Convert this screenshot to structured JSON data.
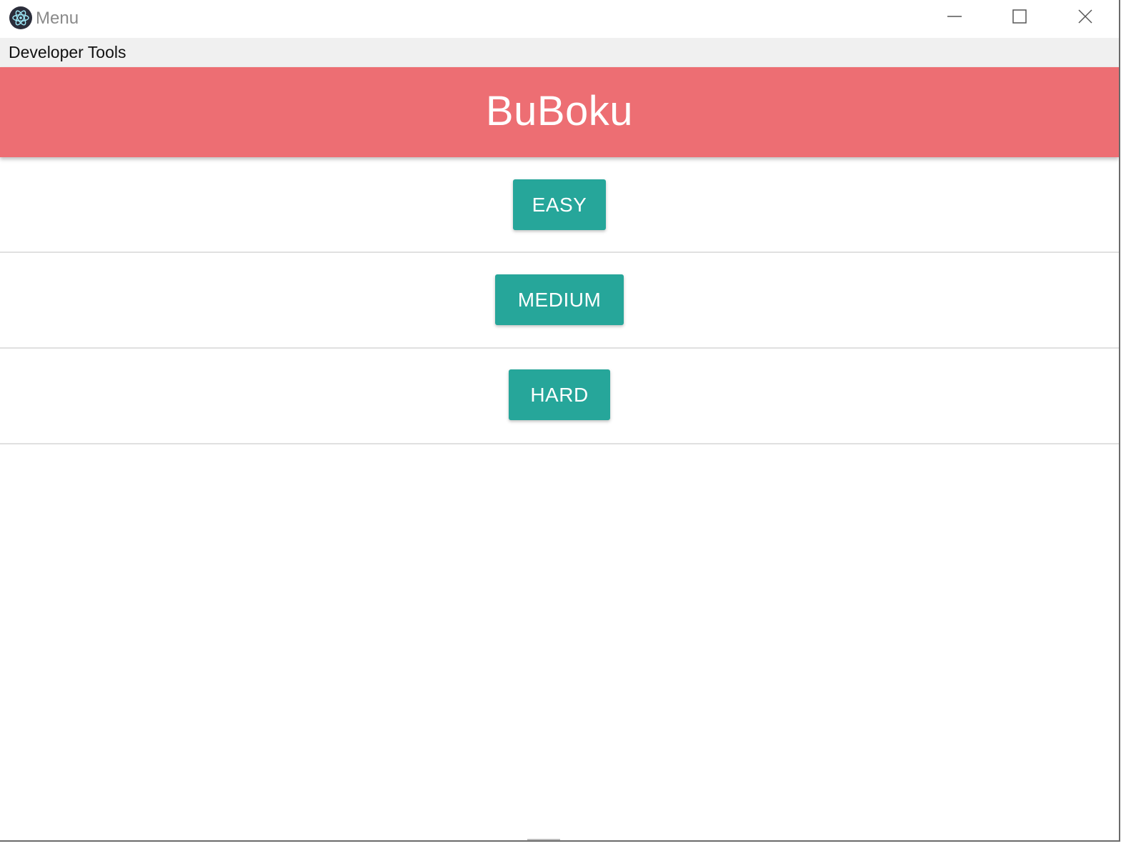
{
  "window": {
    "title": "Menu",
    "icon": "electron-atom-icon",
    "controls": {
      "minimize_icon": "minimize-icon",
      "maximize_icon": "maximize-icon",
      "close_icon": "close-icon"
    }
  },
  "menubar": {
    "items": [
      {
        "label": "Developer Tools"
      }
    ]
  },
  "header": {
    "title": "BuBoku",
    "background_color": "#ed6e73"
  },
  "difficulty": {
    "button_color": "#26a69a",
    "buttons": [
      {
        "label": "EASY"
      },
      {
        "label": "MEDIUM"
      },
      {
        "label": "HARD"
      }
    ]
  }
}
